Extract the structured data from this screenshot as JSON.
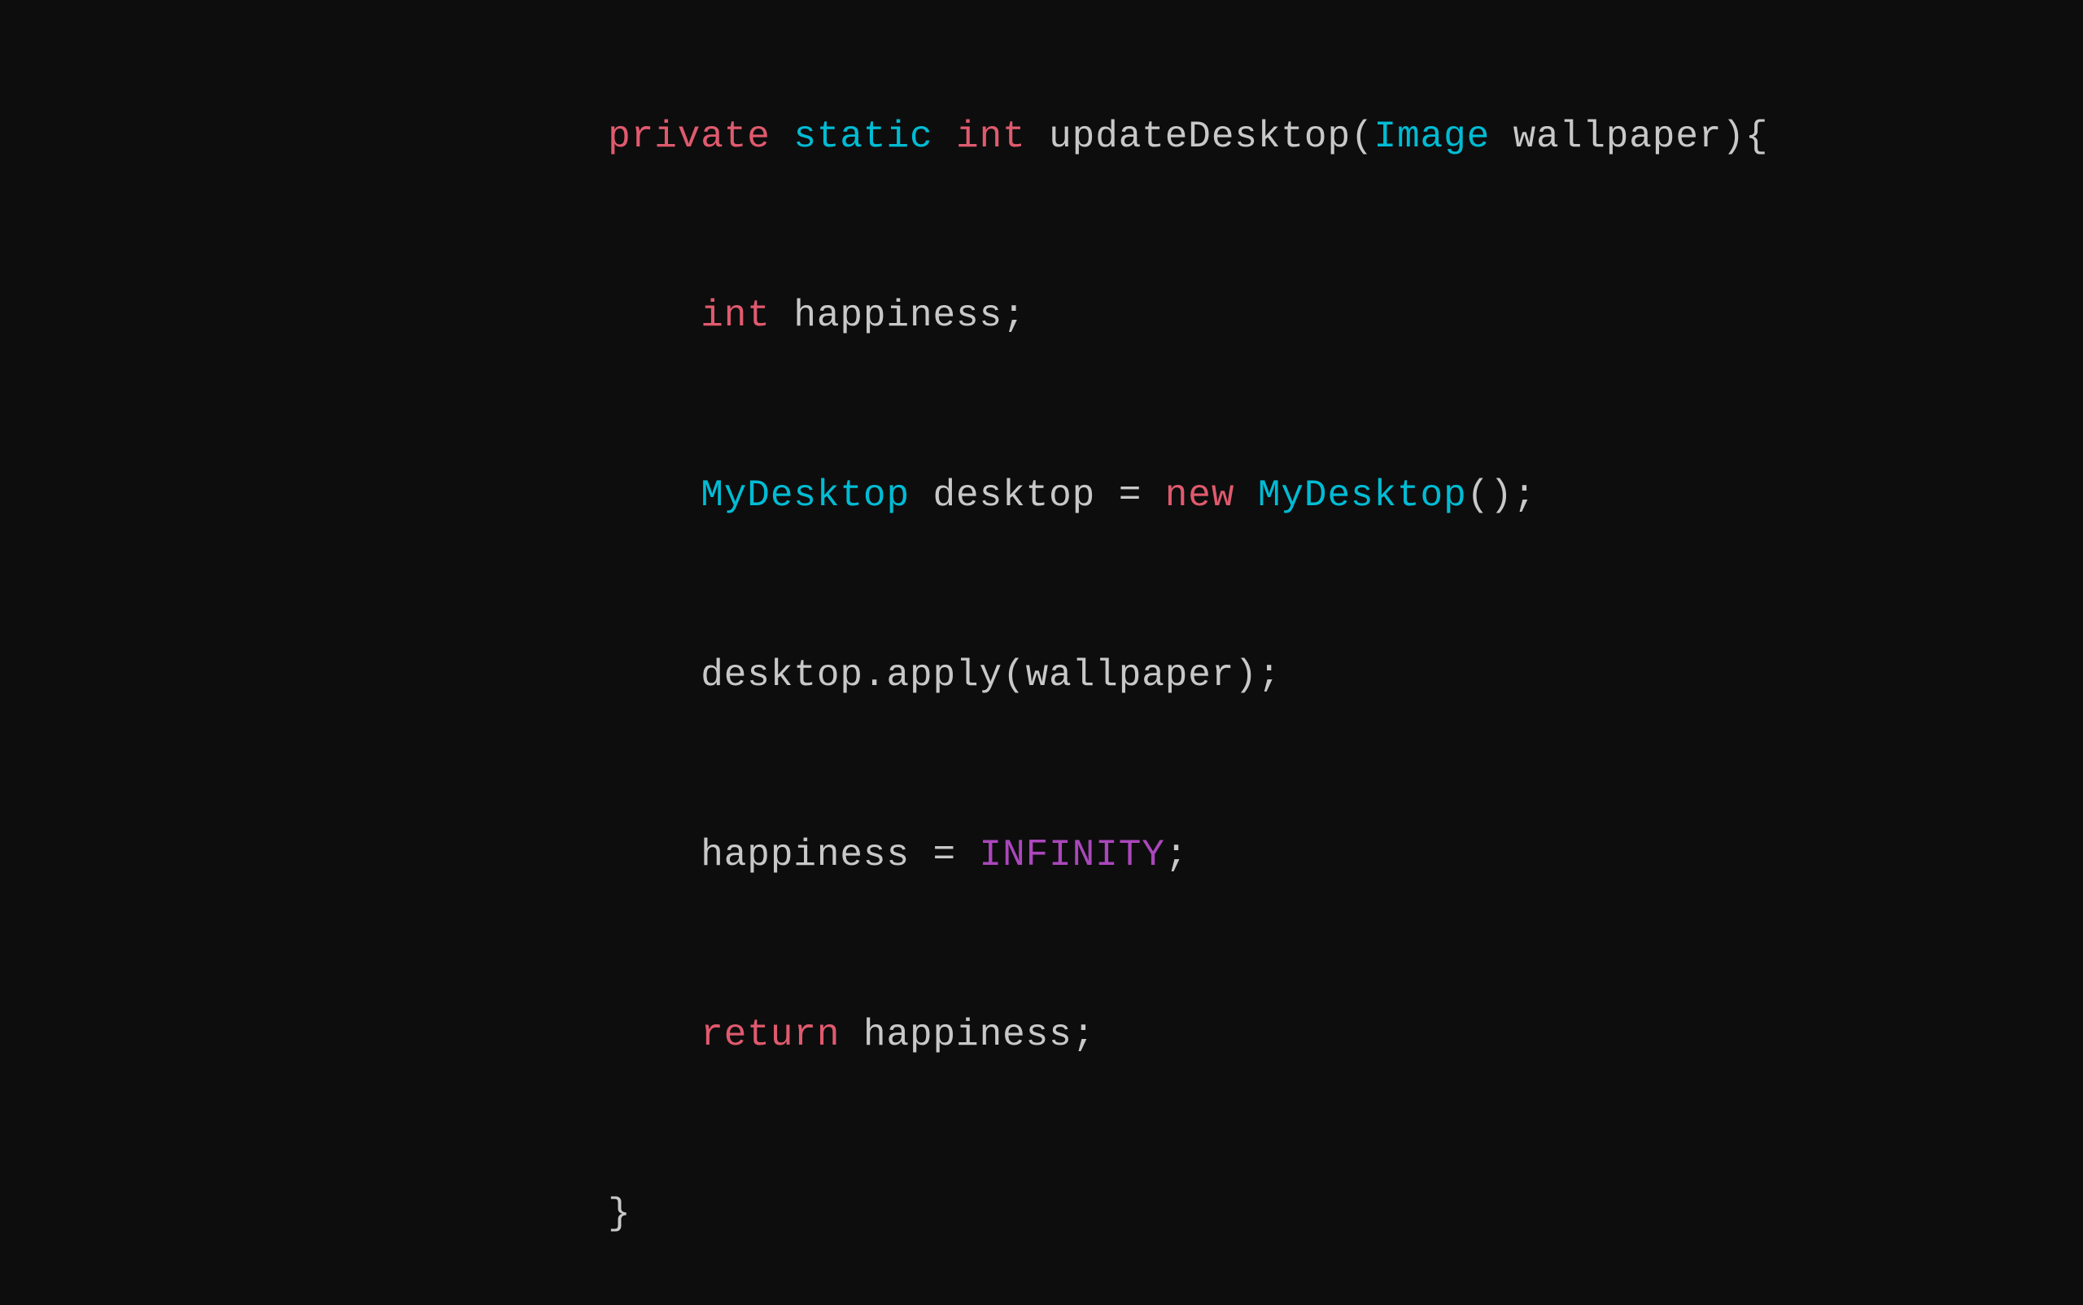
{
  "background": "#0d0d0d",
  "code": {
    "lines": [
      {
        "id": "line1",
        "parts": [
          {
            "text": "private",
            "class": "kw-private"
          },
          {
            "text": " ",
            "class": "plain"
          },
          {
            "text": "static",
            "class": "kw-static"
          },
          {
            "text": " ",
            "class": "plain"
          },
          {
            "text": "int",
            "class": "kw-int"
          },
          {
            "text": " updateDesktop(",
            "class": "plain"
          },
          {
            "text": "Image",
            "class": "type-image"
          },
          {
            "text": " wallpaper){",
            "class": "plain"
          }
        ]
      },
      {
        "id": "line2",
        "indent": "    ",
        "parts": [
          {
            "text": "    ",
            "class": "plain"
          },
          {
            "text": "int",
            "class": "kw-int"
          },
          {
            "text": " happiness;",
            "class": "plain"
          }
        ]
      },
      {
        "id": "line3",
        "parts": [
          {
            "text": "    ",
            "class": "plain"
          },
          {
            "text": "MyDesktop",
            "class": "type-mydesktop"
          },
          {
            "text": " desktop = ",
            "class": "plain"
          },
          {
            "text": "new",
            "class": "kw-new"
          },
          {
            "text": " ",
            "class": "plain"
          },
          {
            "text": "MyDesktop",
            "class": "type-mydesktop"
          },
          {
            "text": "();",
            "class": "plain"
          }
        ]
      },
      {
        "id": "line4",
        "parts": [
          {
            "text": "    desktop.apply(wallpaper);",
            "class": "plain"
          }
        ]
      },
      {
        "id": "line5",
        "parts": [
          {
            "text": "    happiness = ",
            "class": "plain"
          },
          {
            "text": "INFINITY",
            "class": "const-infinity"
          },
          {
            "text": ";",
            "class": "plain"
          }
        ]
      },
      {
        "id": "line6",
        "parts": [
          {
            "text": "    ",
            "class": "plain"
          },
          {
            "text": "return",
            "class": "kw-return"
          },
          {
            "text": " happiness;",
            "class": "plain"
          }
        ]
      },
      {
        "id": "line7",
        "parts": [
          {
            "text": "}",
            "class": "plain"
          }
        ]
      }
    ]
  }
}
